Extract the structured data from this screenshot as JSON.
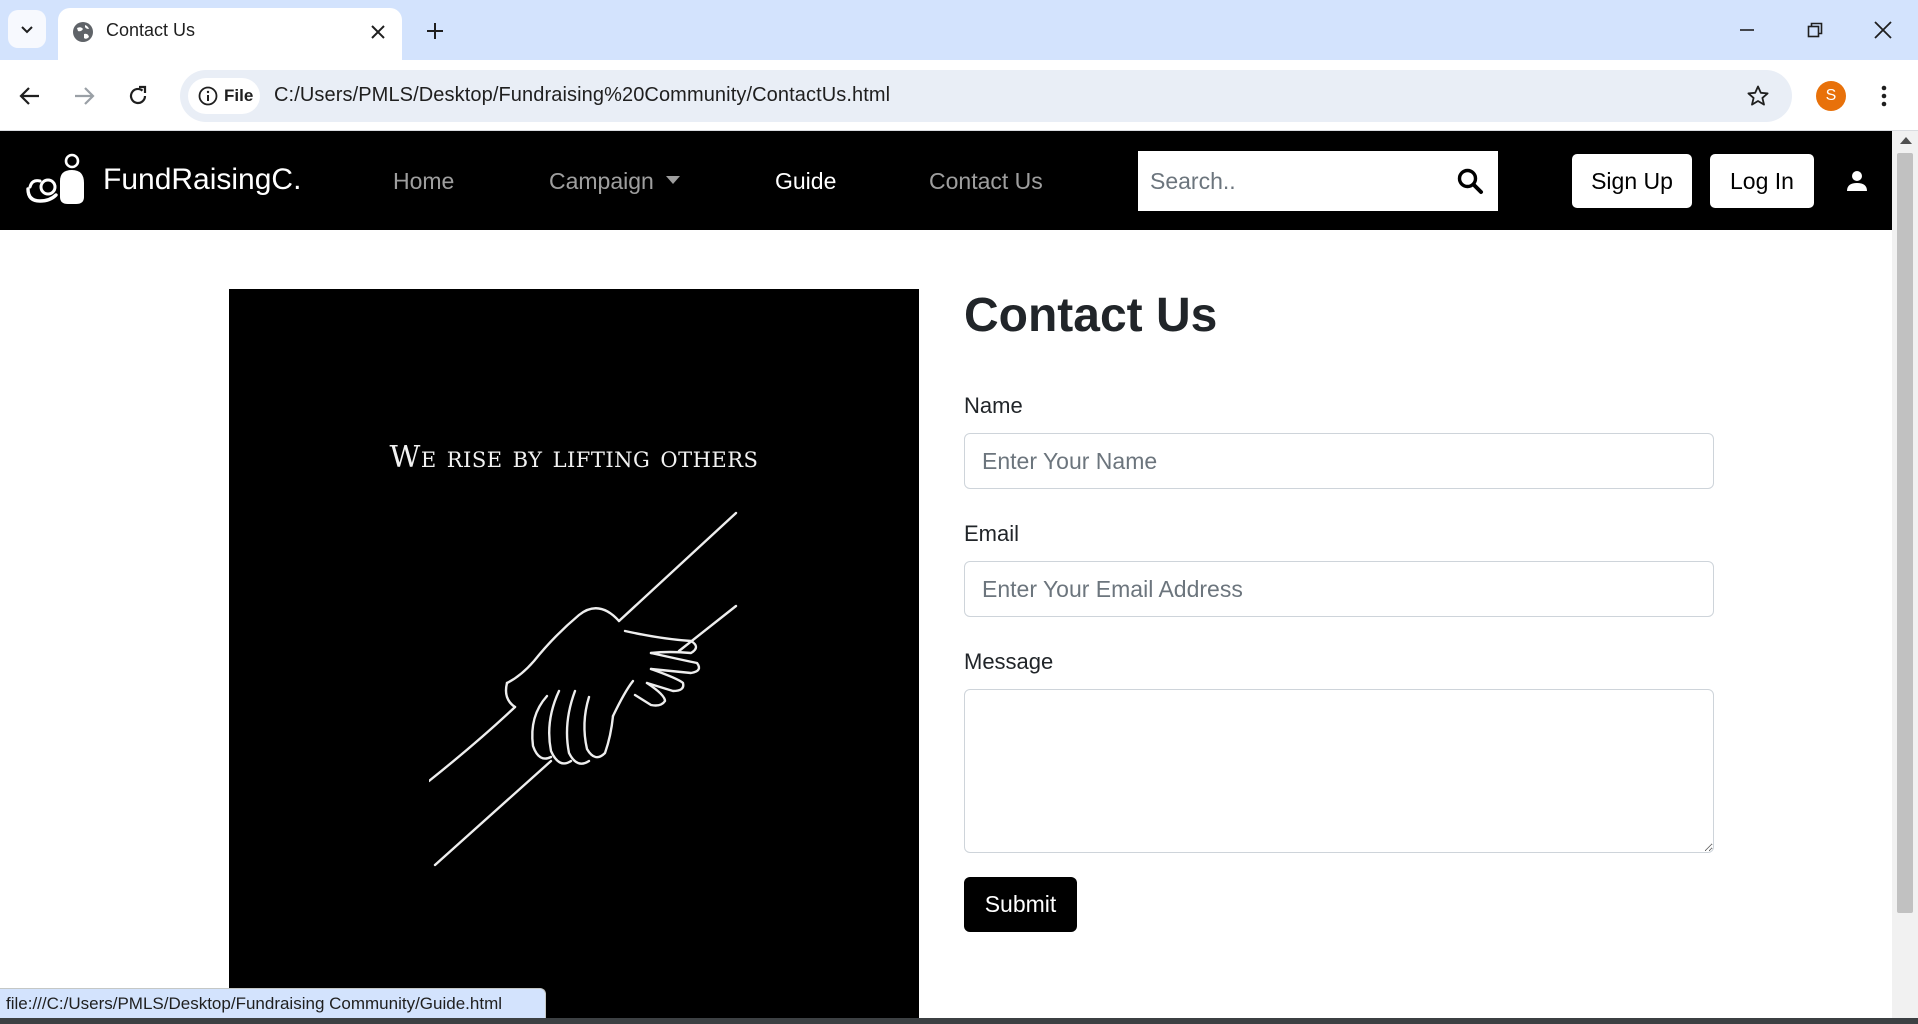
{
  "browser": {
    "tab": {
      "title": "Contact Us"
    },
    "site_chip": "File",
    "url": "C:/Users/PMLS/Desktop/Fundraising%20Community/ContactUs.html",
    "profile_initial": "S",
    "profile_color": "#e8710a",
    "status_url": "file:///C:/Users/PMLS/Desktop/Fundraising Community/Guide.html"
  },
  "navbar": {
    "brand": "FundRaisingC.",
    "links": {
      "home": "Home",
      "campaign": "Campaign",
      "guide": "Guide",
      "contact": "Contact Us"
    },
    "active_link": "Guide",
    "search_placeholder": "Search..",
    "signup": "Sign Up",
    "login": "Log In"
  },
  "hero": {
    "quote": "We rise by lifting others"
  },
  "form": {
    "title": "Contact Us",
    "name_label": "Name",
    "name_placeholder": "Enter Your Name",
    "name_value": "",
    "email_label": "Email",
    "email_placeholder": "Enter Your Email Address",
    "email_value": "",
    "message_label": "Message",
    "message_value": "",
    "submit": "Submit"
  },
  "icons": {
    "tab_favicon": "globe-icon",
    "search": "search-icon",
    "user": "user-icon",
    "brand_logo": "people-logo-icon"
  }
}
